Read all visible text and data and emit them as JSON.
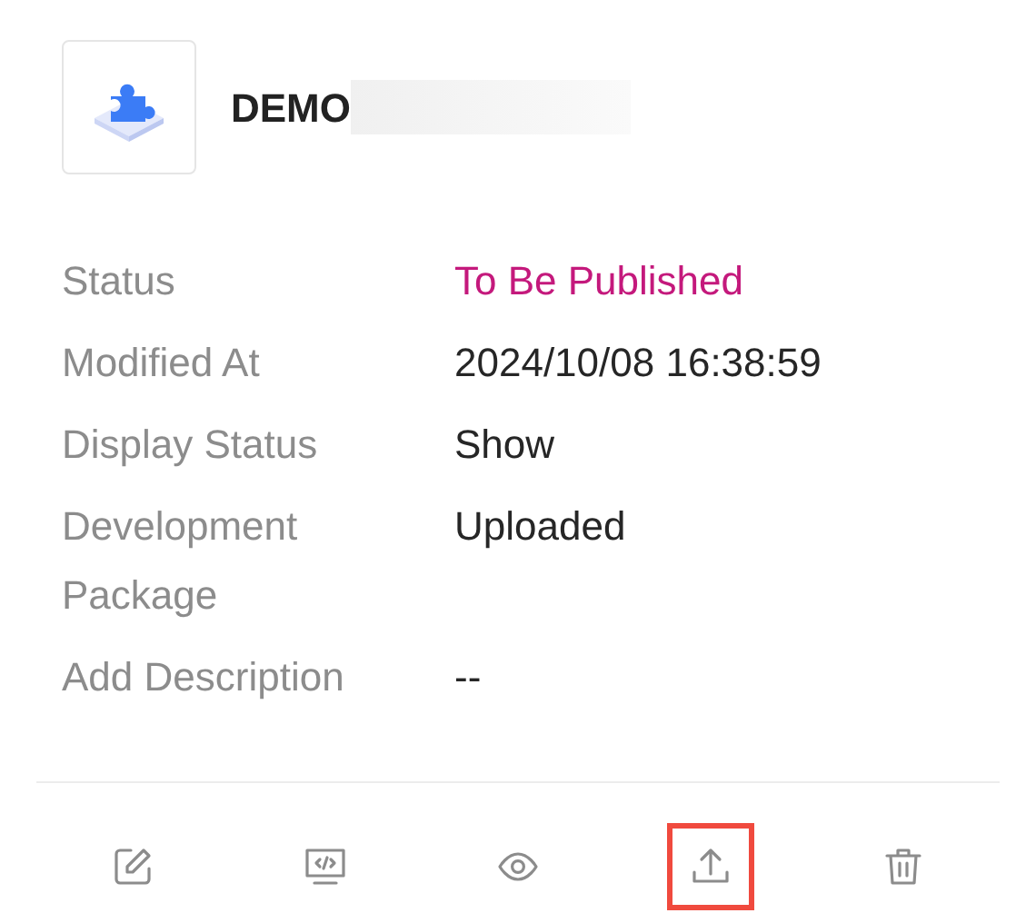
{
  "header": {
    "title": "DEMO",
    "redacted": true
  },
  "fields": [
    {
      "label": "Status",
      "value": "To Be Published",
      "color": "#c4197c"
    },
    {
      "label": "Modified At",
      "value": "2024/10/08 16:38:59",
      "color": "#262626"
    },
    {
      "label": "Display Status",
      "value": "Show",
      "color": "#262626"
    },
    {
      "label": "Development Package",
      "value": "Uploaded",
      "color": "#262626"
    },
    {
      "label": "Add Description",
      "value": "--",
      "color": "#262626"
    }
  ],
  "actions": [
    {
      "kind": "edit",
      "highlighted": false
    },
    {
      "kind": "code",
      "highlighted": false
    },
    {
      "kind": "preview",
      "highlighted": false
    },
    {
      "kind": "upload",
      "highlighted": true
    },
    {
      "kind": "delete",
      "highlighted": false
    }
  ]
}
